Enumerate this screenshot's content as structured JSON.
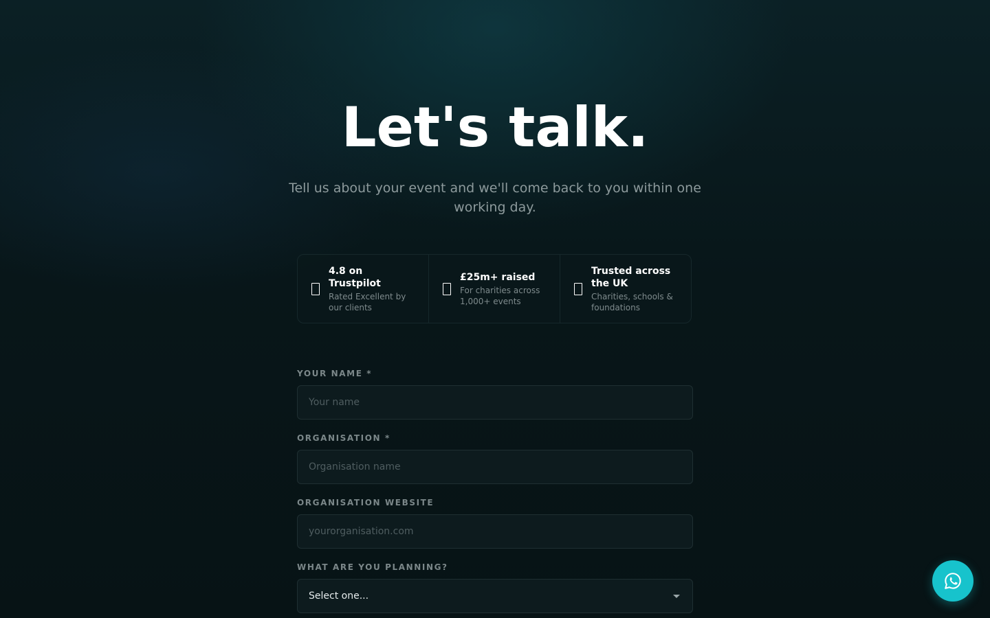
{
  "hero": {
    "title": "Let's talk.",
    "subtitle": "Tell us about your event and we'll come back to you within one working day."
  },
  "stats": [
    {
      "icon": "star-icon",
      "title": "4.8 on Trustpilot",
      "subtitle": "Rated Excellent by our clients"
    },
    {
      "icon": "heart-icon",
      "title": "£25m+ raised",
      "subtitle": "For charities across 1,000+ events"
    },
    {
      "icon": "shield-icon",
      "title": "Trusted across the UK",
      "subtitle": "Charities, schools & foundations"
    }
  ],
  "form": {
    "name": {
      "label": "YOUR NAME *",
      "placeholder": "Your name",
      "value": ""
    },
    "organisation": {
      "label": "ORGANISATION *",
      "placeholder": "Organisation name",
      "value": ""
    },
    "website": {
      "label": "ORGANISATION WEBSITE",
      "placeholder": "yourorganisation.com",
      "value": ""
    },
    "planning": {
      "label": "WHAT ARE YOU PLANNING?",
      "selected": "Select one..."
    }
  },
  "chat": {
    "icon": "whatsapp-icon"
  },
  "colors": {
    "accent": "#17c3cc",
    "background": "#071417",
    "input_background": "#0d1b1e",
    "muted_text": "#7b8789"
  }
}
